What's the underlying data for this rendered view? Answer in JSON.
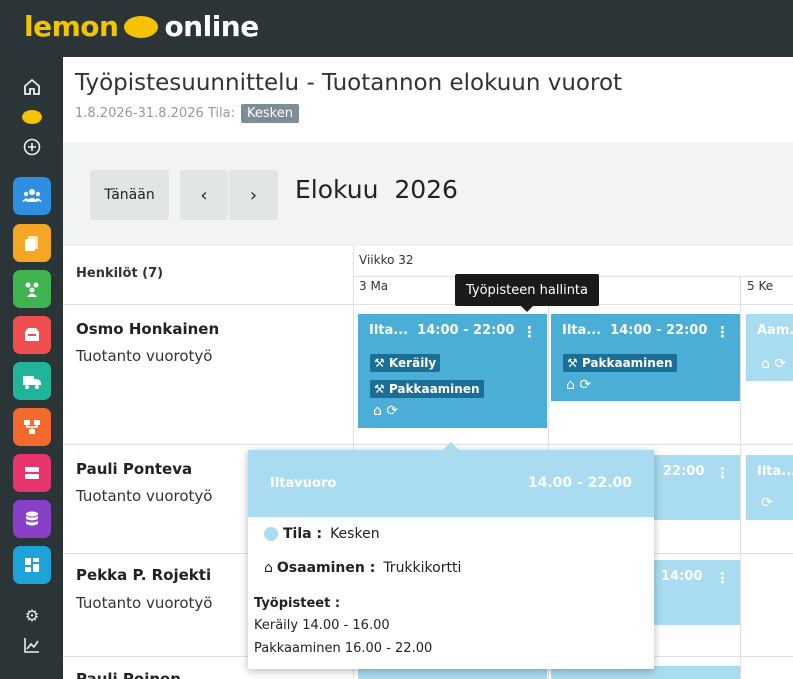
{
  "brand": {
    "word1": "lemon",
    "word2": "online"
  },
  "sidebar": {
    "icons": [
      {
        "name": "home-icon",
        "glyph": "⌂"
      },
      {
        "name": "lemon-icon"
      },
      {
        "name": "add-circle-icon",
        "glyph": "⊕"
      },
      {
        "name": "people-icon",
        "color": "#2e8fe0"
      },
      {
        "name": "documents-icon",
        "color": "#f5a623"
      },
      {
        "name": "team-icon",
        "color": "#3fb34f"
      },
      {
        "name": "inbox-icon",
        "color": "#ef4f4f"
      },
      {
        "name": "truck-icon",
        "color": "#20b49a"
      },
      {
        "name": "workflow-icon",
        "color": "#f26b2c"
      },
      {
        "name": "server-icon",
        "color": "#e8356e"
      },
      {
        "name": "database-icon",
        "color": "#8a3fc9"
      },
      {
        "name": "dashboard-icon",
        "color": "#1ea3d9"
      },
      {
        "name": "settings-icon",
        "glyph": "⚙"
      },
      {
        "name": "chart-icon"
      }
    ]
  },
  "header": {
    "title": "Työpistesuunnittelu - Tuotannon elokuun vuorot",
    "range_label": "1.8.2026-31.8.2026 Tila:",
    "status": "Kesken"
  },
  "toolbar": {
    "today": "Tänään",
    "prev": "‹",
    "next": "›",
    "month": "Elokuu",
    "year": "2026"
  },
  "grid": {
    "persons_header": "Henkilöt (7)",
    "week": "Viikko 32",
    "days": [
      "3 Ma",
      "5 Ke"
    ],
    "people": [
      {
        "name": "Osmo Honkainen",
        "role": "Tuotanto vuorotyö"
      },
      {
        "name": "Pauli Ponteva",
        "role": "Tuotanto vuorotyö"
      },
      {
        "name": "Pekka P. Rojekti",
        "role": "Tuotanto vuorotyö"
      },
      {
        "name": "Pauli Poinen",
        "role": ""
      }
    ],
    "shifts": {
      "s1": {
        "title": "Ilta...",
        "time": "14:00 - 22:00",
        "tags": [
          "Keräily",
          "Pakkaaminen"
        ]
      },
      "s2": {
        "title": "Ilta...",
        "time": "14:00 - 22:00",
        "tags": [
          "Pakkaaminen"
        ]
      },
      "s3": {
        "title": "Aam..."
      },
      "s4": {
        "time": "22:00"
      },
      "s5": {
        "title": "Ilta..."
      },
      "s6": {
        "time": "14:00"
      }
    }
  },
  "tooltip": "Työpisteen hallinta",
  "popup": {
    "name": "Iltavuoro",
    "time": "14.00 - 22.00",
    "state_label": "Tila :",
    "state_value": "Kesken",
    "skill_label": "Osaaminen :",
    "skill_value": "Trukkikortti",
    "workstations_label": "Työpisteet :",
    "workstations": [
      "Keräily 14.00 - 16.00",
      "Pakkaaminen 16.00 - 22.00"
    ]
  }
}
